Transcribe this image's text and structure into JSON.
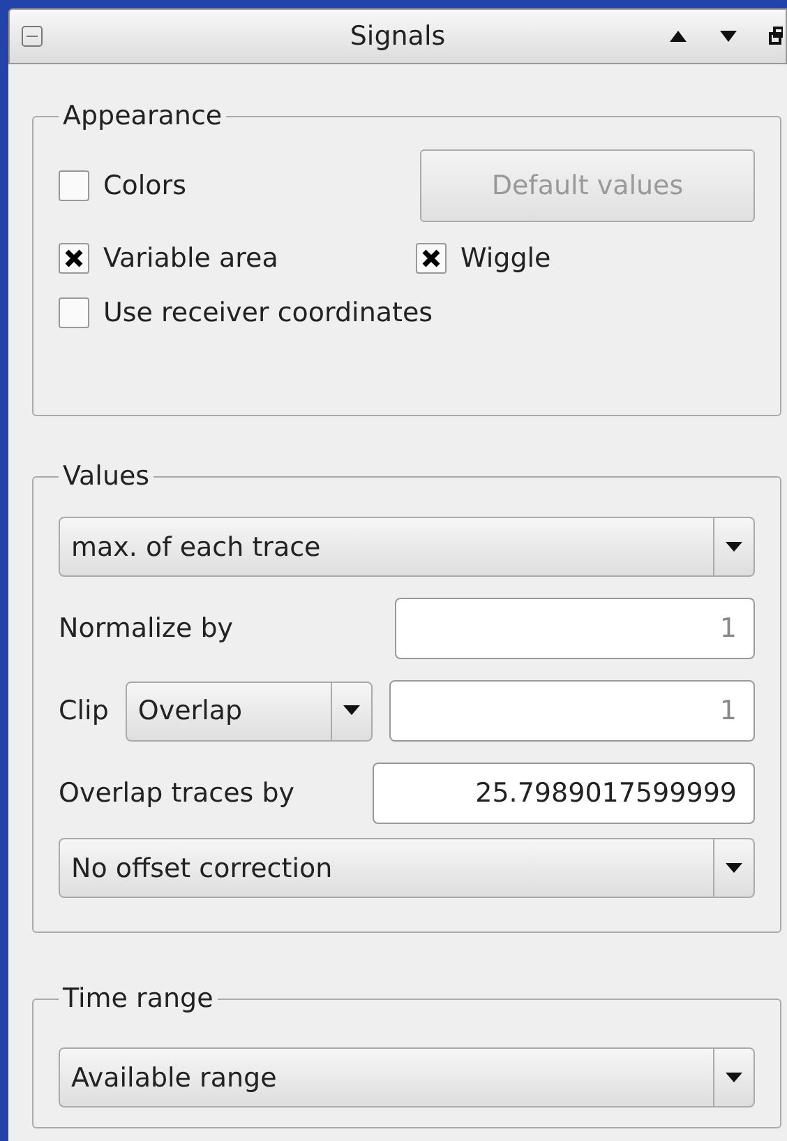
{
  "window": {
    "title": "Signals"
  },
  "appearance": {
    "title": "Appearance",
    "colors": {
      "label": "Colors",
      "checked": false
    },
    "default_button": {
      "label": "Default values",
      "disabled": true
    },
    "variable_area": {
      "label": "Variable area",
      "checked": true
    },
    "wiggle": {
      "label": "Wiggle",
      "checked": true
    },
    "receiver_coords": {
      "label": "Use receiver coordinates",
      "checked": false
    }
  },
  "values": {
    "title": "Values",
    "mode": {
      "value": "max. of each trace"
    },
    "normalize": {
      "label": "Normalize by",
      "value": "1",
      "disabled": true
    },
    "clip": {
      "label": "Clip",
      "mode": "Overlap",
      "value": "1",
      "disabled": true
    },
    "overlap": {
      "label": "Overlap traces by",
      "value": "25.7989017599999",
      "disabled": false
    },
    "offset": {
      "value": "No offset correction"
    }
  },
  "time_range": {
    "title": "Time range",
    "mode": {
      "value": "Available range"
    }
  }
}
